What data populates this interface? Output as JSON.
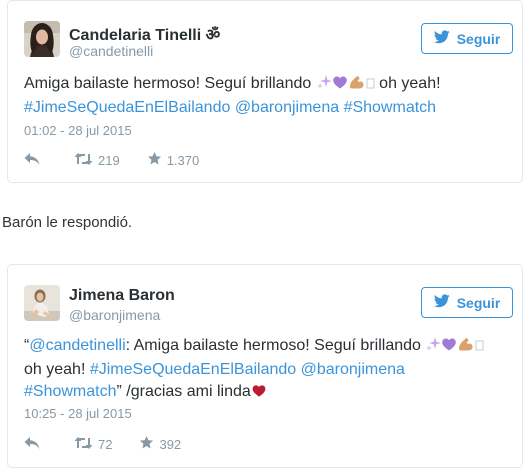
{
  "tweet1": {
    "author_name": "Candelaria Tinelli ॐ",
    "handle": "@candetinelli",
    "follow_label": "Seguir",
    "text_start": "Amiga bailaste hermoso! Seguí brillando ",
    "text_after_emoji": " oh yeah!",
    "hashtag_show": "#JimeSeQuedaEnElBailando",
    "mention": "@baronjimena",
    "hashtag_showmatch": "#Showmatch",
    "timestamp": "01:02 - 28 jul 2015",
    "retweets": "219",
    "likes": "1.370"
  },
  "between_text": "Barón le respondió.",
  "tweet2": {
    "author_name": "Jimena Baron",
    "handle": "@baronjimena",
    "follow_label": "Seguir",
    "quote_open": "“",
    "quoted_mention": "@candetinelli",
    "quote_text": ": Amiga bailaste hermoso! Seguí brillando ",
    "text_after_emoji": "oh yeah! ",
    "hashtag_show": "#JimeSeQuedaEnElBailando",
    "mention": "@baronjimena",
    "hashtag_showmatch": "#Showmatch",
    "quote_close": "” /gracias ami linda",
    "timestamp": "10:25 - 28 jul 2015",
    "retweets": "72",
    "likes": "392"
  },
  "colors": {
    "link": "#3b94d9",
    "muted": "#8899a6",
    "text": "#292f33",
    "border": "#e1e8ed"
  },
  "icons": {
    "bird": "twitter-bird-icon",
    "reply": "reply-icon",
    "retweet": "retweet-icon",
    "like": "star-icon",
    "sparkles": "sparkles-icon",
    "purple_heart": "purple-heart-icon",
    "flexed_biceps": "flexed-biceps-icon",
    "red_heart": "red-heart-icon"
  }
}
